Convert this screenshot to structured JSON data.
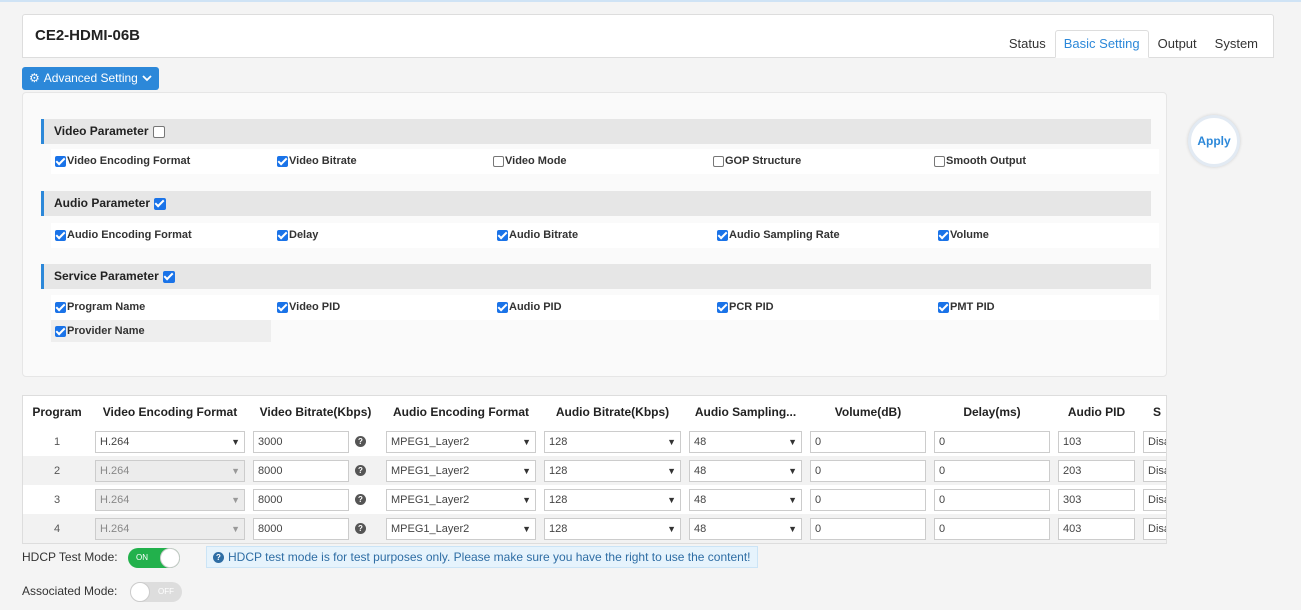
{
  "header": {
    "device_title": "CE2-HDMI-06B",
    "tabs": [
      "Status",
      "Basic Setting",
      "Output",
      "System"
    ],
    "active_tab": "Basic Setting"
  },
  "advanced": {
    "button_label": "Advanced Setting",
    "button_icon": "gear-icon",
    "apply_label": "Apply",
    "sections": [
      {
        "title": "Video Parameter",
        "checked": false,
        "options": [
          {
            "label": "Video Encoding Format",
            "checked": true
          },
          {
            "label": "Video Bitrate",
            "checked": true
          },
          {
            "label": "Video Mode",
            "checked": false
          },
          {
            "label": "GOP Structure",
            "checked": false
          },
          {
            "label": "Smooth Output",
            "checked": false
          }
        ]
      },
      {
        "title": "Audio Parameter",
        "checked": true,
        "options": [
          {
            "label": "Audio Encoding Format",
            "checked": true
          },
          {
            "label": "Delay",
            "checked": true
          },
          {
            "label": "Audio Bitrate",
            "checked": true
          },
          {
            "label": "Audio Sampling Rate",
            "checked": true
          },
          {
            "label": "Volume",
            "checked": true
          }
        ]
      },
      {
        "title": "Service Parameter",
        "checked": true,
        "options": [
          {
            "label": "Program Name",
            "checked": true
          },
          {
            "label": "Video PID",
            "checked": true
          },
          {
            "label": "Audio PID",
            "checked": true
          },
          {
            "label": "PCR PID",
            "checked": true
          },
          {
            "label": "PMT PID",
            "checked": true
          },
          {
            "label": "Provider Name",
            "checked": true
          }
        ]
      }
    ]
  },
  "table": {
    "headers": [
      "Program",
      "Video Encoding Format",
      "Video Bitrate(Kbps)",
      "Audio Encoding Format",
      "Audio Bitrate(Kbps)",
      "Audio Sampling...",
      "Volume(dB)",
      "Delay(ms)",
      "Audio PID",
      "S"
    ],
    "rows": [
      {
        "program": "1",
        "video_format": "H.264",
        "video_bitrate": "3000",
        "audio_format": "MPEG1_Layer2",
        "audio_bitrate": "128",
        "sampling": "48",
        "volume": "0",
        "delay": "0",
        "audio_pid": "103",
        "s": "Disab"
      },
      {
        "program": "2",
        "video_format": "H.264",
        "video_bitrate": "8000",
        "audio_format": "MPEG1_Layer2",
        "audio_bitrate": "128",
        "sampling": "48",
        "volume": "0",
        "delay": "0",
        "audio_pid": "203",
        "s": "Disab"
      },
      {
        "program": "3",
        "video_format": "H.264",
        "video_bitrate": "8000",
        "audio_format": "MPEG1_Layer2",
        "audio_bitrate": "128",
        "sampling": "48",
        "volume": "0",
        "delay": "0",
        "audio_pid": "303",
        "s": "Disab"
      },
      {
        "program": "4",
        "video_format": "H.264",
        "video_bitrate": "8000",
        "audio_format": "MPEG1_Layer2",
        "audio_bitrate": "128",
        "sampling": "48",
        "volume": "0",
        "delay": "0",
        "audio_pid": "403",
        "s": "Disab"
      }
    ]
  },
  "hdcp": {
    "label": "HDCP Test Mode:",
    "state": "ON",
    "notice": "HDCP test mode is for test purposes only. Please make sure you have the right to use the content!"
  },
  "associated": {
    "label": "Associated Mode:",
    "state": "OFF"
  },
  "colors": {
    "accent": "#2c88d9",
    "toggle_on": "#22b14c",
    "checkbox_on": "#1a73e8"
  }
}
